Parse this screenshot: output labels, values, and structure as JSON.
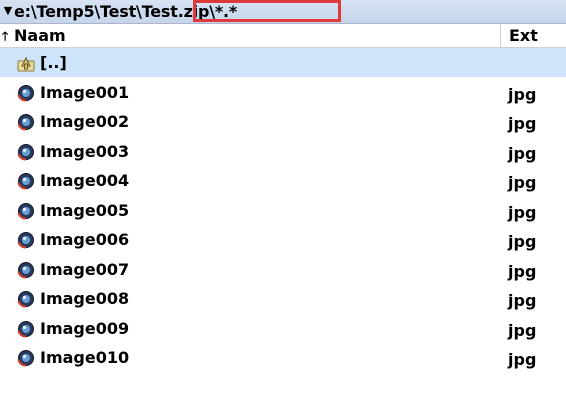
{
  "path_bar": {
    "dropdown_icon": "chevron-down-icon",
    "path": "e:\\Temp5\\Test\\Test.zip\\*.*"
  },
  "columns": {
    "sort_icon": "sort-up-arrow-icon",
    "name": "Naam",
    "ext": "Ext"
  },
  "parent_row": {
    "icon": "folder-up-icon",
    "label": "[..]"
  },
  "files": [
    {
      "name": "Image001",
      "ext": "jpg",
      "icon": "image-file-icon"
    },
    {
      "name": "Image002",
      "ext": "jpg",
      "icon": "image-file-icon"
    },
    {
      "name": "Image003",
      "ext": "jpg",
      "icon": "image-file-icon"
    },
    {
      "name": "Image004",
      "ext": "jpg",
      "icon": "image-file-icon"
    },
    {
      "name": "Image005",
      "ext": "jpg",
      "icon": "image-file-icon"
    },
    {
      "name": "Image006",
      "ext": "jpg",
      "icon": "image-file-icon"
    },
    {
      "name": "Image007",
      "ext": "jpg",
      "icon": "image-file-icon"
    },
    {
      "name": "Image008",
      "ext": "jpg",
      "icon": "image-file-icon"
    },
    {
      "name": "Image009",
      "ext": "jpg",
      "icon": "image-file-icon"
    },
    {
      "name": "Image010",
      "ext": "jpg",
      "icon": "image-file-icon"
    }
  ],
  "colors": {
    "path_bar_bg": "#cfdcf0",
    "selected_row_bg": "#cde4fb",
    "highlight_box": "#e0393c"
  }
}
